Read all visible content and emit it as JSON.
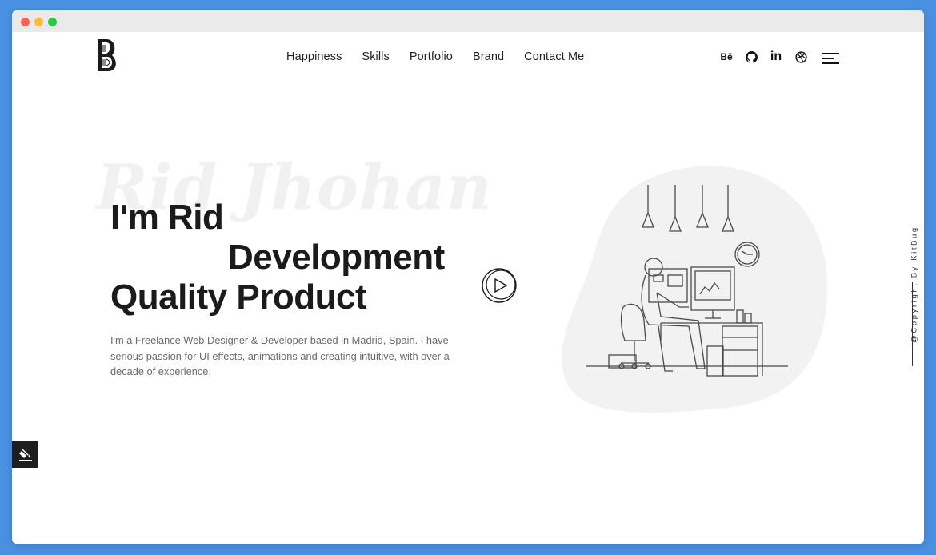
{
  "nav": {
    "items": [
      "Happiness",
      "Skills",
      "Portfolio",
      "Brand",
      "Contact Me"
    ]
  },
  "social": {
    "behance_label": "Bē",
    "linkedin_label": "in",
    "icons": [
      "behance-icon",
      "github-icon",
      "linkedin-icon",
      "dribbble-icon"
    ]
  },
  "hero": {
    "watermark": "Rid Jhohan",
    "line1": "I'm Rid",
    "line2": "Development",
    "line3": "Quality Product",
    "description": "I'm a Freelance Web Designer & Developer based in Madrid, Spain. I have serious passion for UI effects, animations and creating intuitive, with over a decade of experience."
  },
  "side": {
    "copyright": "@Copyright By KitBug"
  },
  "colors": {
    "accent": "#1b1b1b",
    "frame": "#4a90e2",
    "blob": "#f2f2f2"
  }
}
